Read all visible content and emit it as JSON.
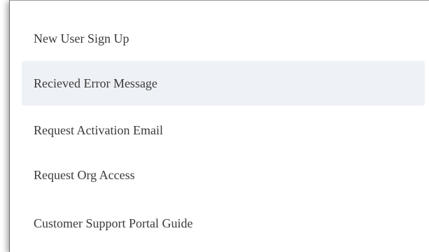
{
  "menu": {
    "items": [
      {
        "label": "New User Sign Up",
        "selected": false
      },
      {
        "label": "Recieved Error Message",
        "selected": true
      },
      {
        "label": "Request Activation Email",
        "selected": false
      },
      {
        "label": "Request Org Access",
        "selected": false
      },
      {
        "label": "Customer Support Portal Guide",
        "selected": false
      }
    ],
    "highlight_color": "#eef1f5",
    "text_color": "#3a3a3a"
  }
}
